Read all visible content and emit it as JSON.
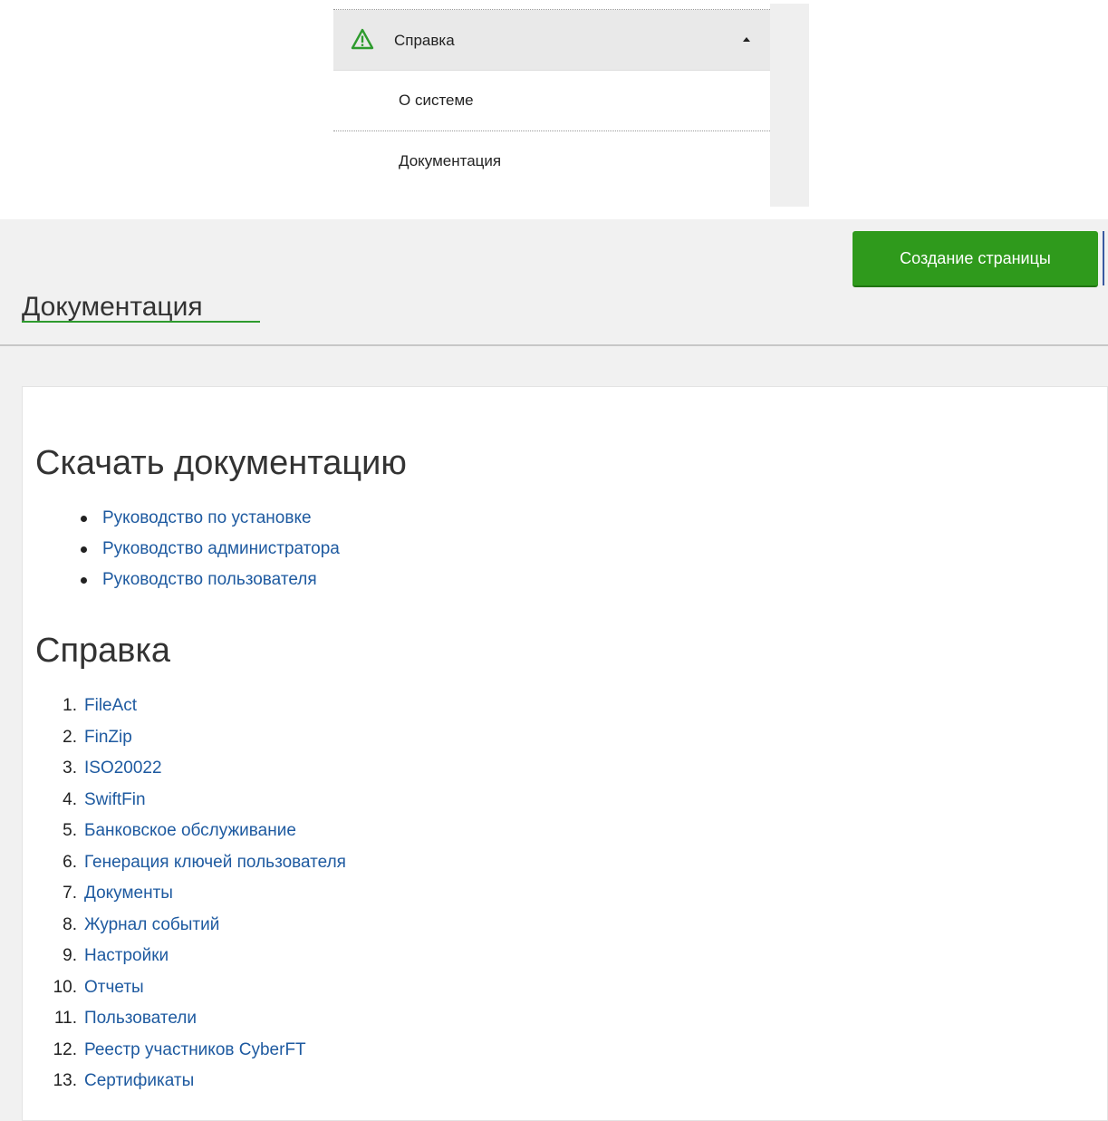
{
  "menu": {
    "header_label": "Справка",
    "items": [
      "О системе",
      "Документация"
    ]
  },
  "page": {
    "title": "Документация",
    "create_button": "Создание страницы"
  },
  "sections": {
    "download": {
      "title": "Скачать документацию",
      "links": [
        "Руководство по установке",
        "Руководство администратора",
        "Руководство пользователя"
      ]
    },
    "help": {
      "title": "Справка",
      "items": [
        {
          "n": "1.",
          "label": "FileAct"
        },
        {
          "n": "2.",
          "label": "FinZip"
        },
        {
          "n": "3.",
          "label": "ISO20022"
        },
        {
          "n": "4.",
          "label": "SwiftFin"
        },
        {
          "n": "5.",
          "label": "Банковское обслуживание"
        },
        {
          "n": "6.",
          "label": "Генерация ключей пользователя"
        },
        {
          "n": "7.",
          "label": "Документы"
        },
        {
          "n": "8.",
          "label": "Журнал событий"
        },
        {
          "n": "9.",
          "label": "Настройки"
        },
        {
          "n": "10.",
          "label": "Отчеты"
        },
        {
          "n": "11.",
          "label": "Пользователи"
        },
        {
          "n": "12.",
          "label": "Реестр участников CyberFT"
        },
        {
          "n": "13.",
          "label": "Сертификаты"
        }
      ]
    }
  },
  "colors": {
    "accent_green": "#2f9a1c",
    "link_blue": "#1e5aa0",
    "warning_icon": "#2e9b2e"
  }
}
